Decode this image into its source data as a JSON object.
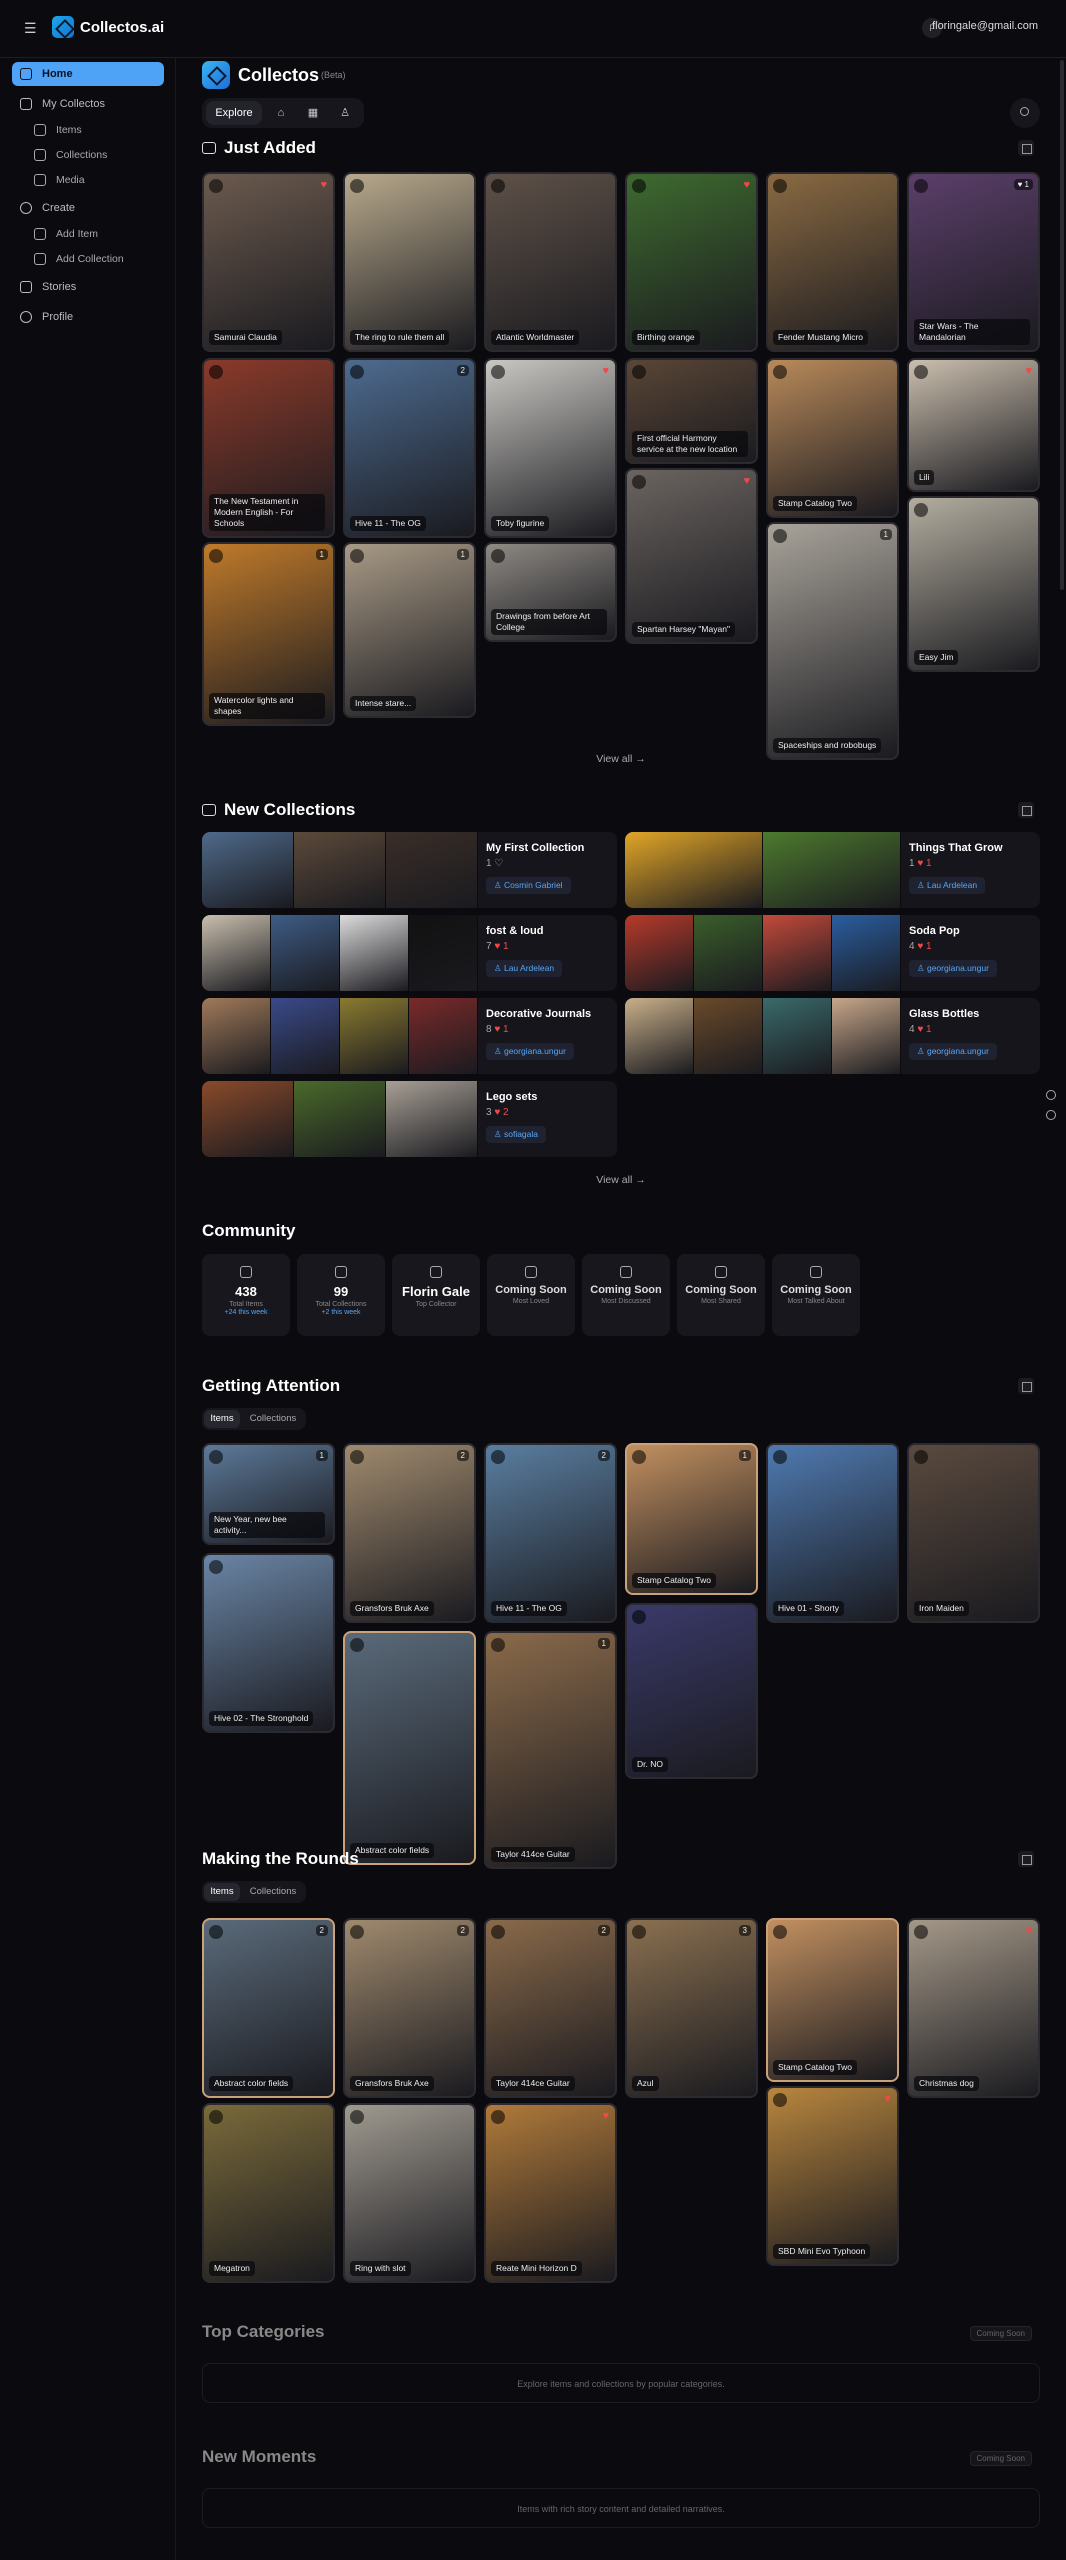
{
  "topbar": {
    "menu_icon": "☰",
    "brand": "Collectos.ai",
    "user_initial": "F",
    "user_email": "floringale@gmail.com"
  },
  "sidebar": {
    "items": [
      {
        "label": "Home"
      },
      {
        "label": "My Collectos"
      },
      {
        "label": "Items"
      },
      {
        "label": "Collections"
      },
      {
        "label": "Media"
      },
      {
        "label": "Create"
      },
      {
        "label": "Add Item"
      },
      {
        "label": "Add Collection"
      },
      {
        "label": "Stories"
      },
      {
        "label": "Profile"
      }
    ]
  },
  "header": {
    "title": "Collectos",
    "beta": "(Beta)",
    "tabs": [
      {
        "label": "Explore"
      },
      {
        "label": "⌂"
      },
      {
        "label": "▦"
      },
      {
        "label": "♙"
      }
    ]
  },
  "just_added": {
    "title": "Just Added",
    "items": [
      {
        "label": "Samurai Claudia",
        "color": "#6b5a4e",
        "heart": "♥"
      },
      {
        "label": "The ring to rule them all",
        "color": "#b8a98c"
      },
      {
        "label": "Atlantic Worldmaster",
        "color": "#5e5148"
      },
      {
        "label": "Birthing orange",
        "color": "#3e6a2f",
        "heart": "♥"
      },
      {
        "label": "Fender Mustang Micro",
        "color": "#8a6a42"
      },
      {
        "label": "Star Wars - The Mandalorian",
        "color": "#5b3f6a",
        "count": "♥ 1"
      },
      {
        "label": "The New Testament in Modern English - For Schools",
        "color": "#8a3a2a"
      },
      {
        "label": "Hive 11 - The OG",
        "color": "#4d6b8f",
        "count": "2"
      },
      {
        "label": "Toby figurine",
        "color": "#c9c7c2",
        "heart": "♥"
      },
      {
        "label": "First official Harmony service at the new location",
        "color": "#5a4636"
      },
      {
        "label": "Stamp Catalog Two",
        "color": "#b98a5a"
      },
      {
        "label": "Lili",
        "color": "#cbbfae",
        "heart": "♥"
      },
      {
        "label": "Spartan Harsey \"Mayan\"",
        "color": "#6b6460",
        "heart": "♥"
      },
      {
        "label": "Drawings from before Art College",
        "color": "#8e8a84"
      },
      {
        "label": "Spaceships and robobugs",
        "color": "#a8a39a",
        "count": "1"
      },
      {
        "label": "Easy Jim",
        "color": "#b3ad9f"
      },
      {
        "label": "Watercolor lights and shapes",
        "color": "#c07a2a",
        "count": "1"
      },
      {
        "label": "Intense stare...",
        "color": "#a89a86",
        "count": "1"
      }
    ],
    "view_all": "View all →"
  },
  "new_collections": {
    "title": "New Collections",
    "items": [
      {
        "title": "My First Collection",
        "meta": "1 ♡",
        "owner": "♙ Cosmin Gabriel",
        "colors": [
          "#4f6a8a",
          "#5c4a3a",
          "#3a2e28"
        ]
      },
      {
        "title": "Things That Grow",
        "meta": "1",
        "hearts": "♥ 1",
        "owner": "♙ Lau Ardelean",
        "colors": [
          "#e2a628",
          "#4d7a2e"
        ]
      },
      {
        "title": "fost & loud",
        "meta": "7",
        "hearts": "♥ 1",
        "owner": "♙ Lau Ardelean",
        "colors": [
          "#c9bfae",
          "#3e5c85",
          "#dcdcdc",
          "#111111"
        ]
      },
      {
        "title": "Soda Pop",
        "meta": "4",
        "hearts": "♥ 1",
        "owner": "♙ georgiana.ungur",
        "colors": [
          "#b73a2a",
          "#3a5e2a",
          "#c34a3a",
          "#2a5ea0"
        ]
      },
      {
        "title": "Decorative Journals",
        "meta": "8",
        "hearts": "♥ 1",
        "owner": "♙ georgiana.ungur",
        "colors": [
          "#a07a5a",
          "#3a4a8a",
          "#8a7a30",
          "#7a2a2a"
        ]
      },
      {
        "title": "Glass Bottles",
        "meta": "4",
        "hearts": "♥ 1",
        "owner": "♙ georgiana.ungur",
        "colors": [
          "#c9b08a",
          "#6a4a2a",
          "#3a6a6a",
          "#c7a78a"
        ]
      },
      {
        "title": "Lego sets",
        "meta": "3",
        "hearts": "♥ 2",
        "owner": "♙ sofiagala",
        "colors": [
          "#8a4a2a",
          "#4a6a2a",
          "#a8a096"
        ]
      }
    ],
    "view_all": "View all →"
  },
  "community": {
    "title": "Community",
    "stats": [
      {
        "value": "438",
        "label": "Total Items",
        "delta": "+24 this week"
      },
      {
        "value": "99",
        "label": "Total Collections",
        "delta": "+2 this week"
      },
      {
        "value": "Florin Gale",
        "label": "Top Collector",
        "delta": ""
      },
      {
        "value": "Coming Soon",
        "label": "Most Loved",
        "delta": ""
      },
      {
        "value": "Coming Soon",
        "label": "Most Discussed",
        "delta": ""
      },
      {
        "value": "Coming Soon",
        "label": "Most Shared",
        "delta": ""
      },
      {
        "value": "Coming Soon",
        "label": "Most Talked About",
        "delta": ""
      }
    ]
  },
  "getting_attention": {
    "title": "Getting Attention",
    "tabs": [
      {
        "label": "Items"
      },
      {
        "label": "Collections"
      }
    ],
    "items": [
      {
        "label": "New Year, new bee activity...",
        "color": "#5d7a9a",
        "count": "1"
      },
      {
        "label": "Gransfors Bruk Axe",
        "color": "#a08a6e",
        "count": "2"
      },
      {
        "label": "Hive 11 - The OG",
        "color": "#5a7ea0",
        "count": "2"
      },
      {
        "label": "Stamp Catalog Two",
        "color": "#c29060",
        "count": "1"
      },
      {
        "label": "Hive 01 - Shorty",
        "color": "#4f7ab0"
      },
      {
        "label": "Iron Maiden",
        "color": "#5a4a3e"
      },
      {
        "label": "Hive 02 - The Stronghold",
        "color": "#6a85a5"
      },
      {
        "label": "Abstract color fields",
        "color": "#5a6a7a"
      },
      {
        "label": "Taylor 414ce Guitar",
        "color": "#8a6a4a",
        "count": "1"
      },
      {
        "label": "Dr. NO",
        "color": "#3a3a6a"
      }
    ]
  },
  "making_the_rounds": {
    "title": "Making the Rounds",
    "tabs": [
      {
        "label": "Items"
      },
      {
        "label": "Collections"
      }
    ],
    "items": [
      {
        "label": "Abstract color fields",
        "color": "#5a6a7a",
        "count": "2"
      },
      {
        "label": "Gransfors Bruk Axe",
        "color": "#a08a6e",
        "count": "2"
      },
      {
        "label": "Taylor 414ce Guitar",
        "color": "#8a6a4a",
        "count": "2"
      },
      {
        "label": "Azul",
        "color": "#8a7050",
        "count": "3"
      },
      {
        "label": "Stamp Catalog Two",
        "color": "#c29060"
      },
      {
        "label": "Christmas dog",
        "color": "#a49888",
        "heart": "♥"
      },
      {
        "label": "Megatron",
        "color": "#7a6a3a"
      },
      {
        "label": "Ring with slot",
        "color": "#a09a90"
      },
      {
        "label": "Reate Mini Horizon D",
        "color": "#b07a3a",
        "heart": "♥"
      },
      {
        "label": "SBD Mini Evo Typhoon",
        "color": "#b8863e",
        "heart": "♥"
      }
    ]
  },
  "top_categories": {
    "title": "Top Categories",
    "tag": "Coming Soon",
    "text": "Explore items and collections by popular categories."
  },
  "new_moments": {
    "title": "New Moments",
    "tag": "Coming Soon",
    "text": "Items with rich story content and detailed narratives."
  }
}
